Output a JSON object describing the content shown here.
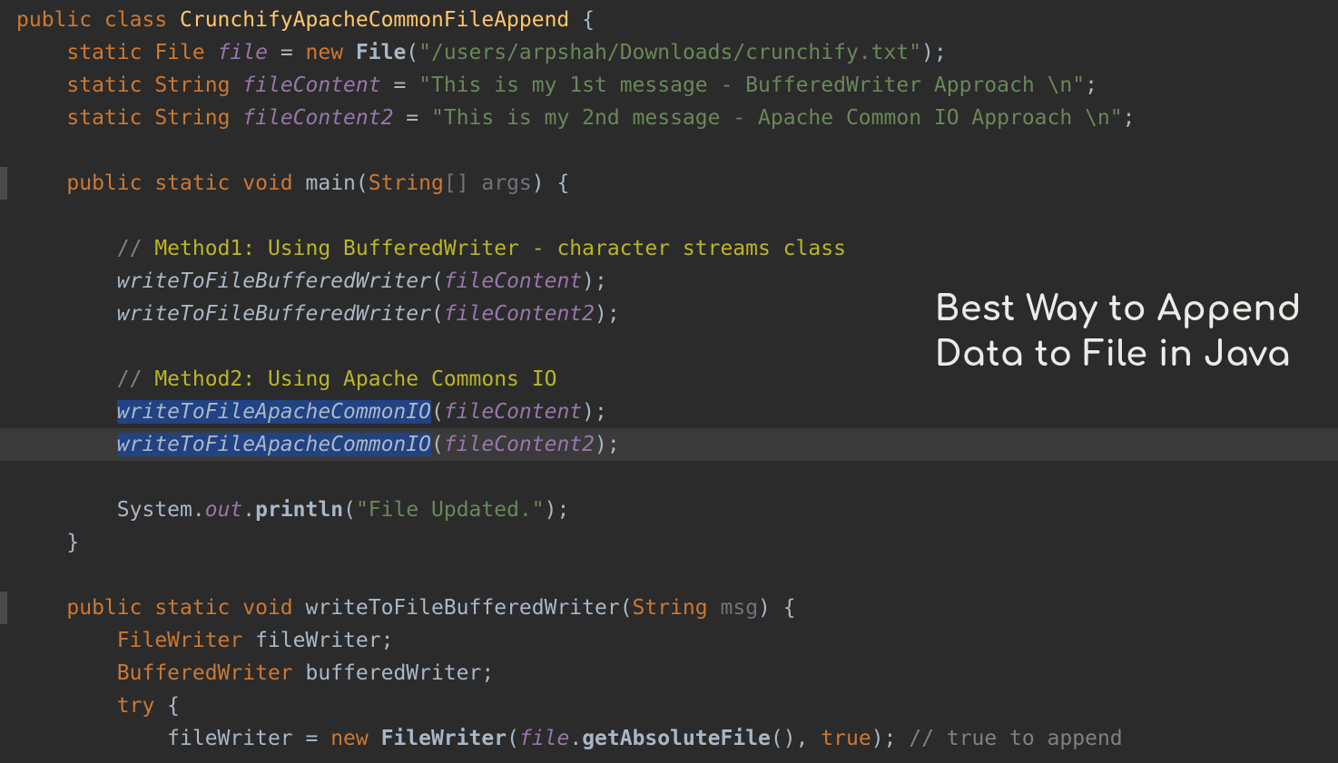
{
  "overlay": {
    "line1": "Best Way to Append",
    "line2": "Data to File in Java"
  },
  "code": {
    "l1": {
      "kw1": "public class ",
      "cls": "CrunchifyApacheCommonFileAppend",
      "brace": " {"
    },
    "l2": {
      "indent": "    ",
      "kw": "static ",
      "type": "File",
      "sp1": " ",
      "field": "file",
      "eq": " = ",
      "nkw": "new ",
      "ctor": "File",
      "op": "(",
      "str": "\"/users/arpshah/Downloads/crunchify.txt\"",
      "cl": ");"
    },
    "l3": {
      "indent": "    ",
      "kw": "static ",
      "type": "String",
      "sp1": " ",
      "field": "fileContent",
      "eq": " = ",
      "str": "\"This is my 1st message - BufferedWriter Approach \\n\"",
      "sc": ";"
    },
    "l4": {
      "indent": "    ",
      "kw": "static ",
      "type": "String",
      "sp1": " ",
      "field": "fileContent2",
      "eq": " = ",
      "str": "\"This is my 2nd message - Apache Common IO Approach \\n\"",
      "sc": ";"
    },
    "l6": {
      "indent": "    ",
      "kw": "public static void ",
      "m": "main",
      "op": "(",
      "ptype": "String",
      "arr": "[] ",
      "pn": "args",
      "cl": ") {"
    },
    "l8": {
      "indent": "        ",
      "c1": "// ",
      "c2": "Method1: Using BufferedWriter - character streams class"
    },
    "l9": {
      "indent": "        ",
      "m": "writeToFileBufferedWriter",
      "op": "(",
      "arg": "fileContent",
      "cl": ");"
    },
    "l10": {
      "indent": "        ",
      "m": "writeToFileBufferedWriter",
      "op": "(",
      "arg": "fileContent2",
      "cl": ");"
    },
    "l12": {
      "indent": "        ",
      "c1": "// ",
      "c2": "Method2: Using Apache Commons IO"
    },
    "l13": {
      "indent": "        ",
      "m": "writeToFileApacheCommonIO",
      "op": "(",
      "arg": "fileContent",
      "cl": ");"
    },
    "l14": {
      "indent": "        ",
      "m": "writeToFileApacheCommonIO",
      "op": "(",
      "arg": "fileContent2",
      "cl": ");"
    },
    "l16": {
      "indent": "        ",
      "sys": "System",
      "dot1": ".",
      "out": "out",
      "dot2": ".",
      "pl": "println",
      "op": "(",
      "str": "\"File Updated.\"",
      "cl": ");"
    },
    "l17": {
      "indent": "    ",
      "brace": "}"
    },
    "l19": {
      "indent": "    ",
      "kw": "public static void ",
      "m": "writeToFileBufferedWriter",
      "op": "(",
      "ptype": "String",
      "sp": " ",
      "pn": "msg",
      "cl": ") {"
    },
    "l20": {
      "indent": "        ",
      "type": "FileWriter",
      "sp": " ",
      "v": "fileWriter",
      "sc": ";"
    },
    "l21": {
      "indent": "        ",
      "type": "BufferedWriter",
      "sp": " ",
      "v": "bufferedWriter",
      "sc": ";"
    },
    "l22": {
      "indent": "        ",
      "kw": "try ",
      "brace": "{"
    },
    "l23": {
      "indent": "            ",
      "v": "fileWriter",
      "eq": " = ",
      "nkw": "new ",
      "ctor": "FileWriter",
      "op": "(",
      "f": "file",
      "dot": ".",
      "m": "getAbsoluteFile",
      "p2": "(), ",
      "tru": "true",
      "cl": "); ",
      "cm": "// true to append"
    }
  }
}
